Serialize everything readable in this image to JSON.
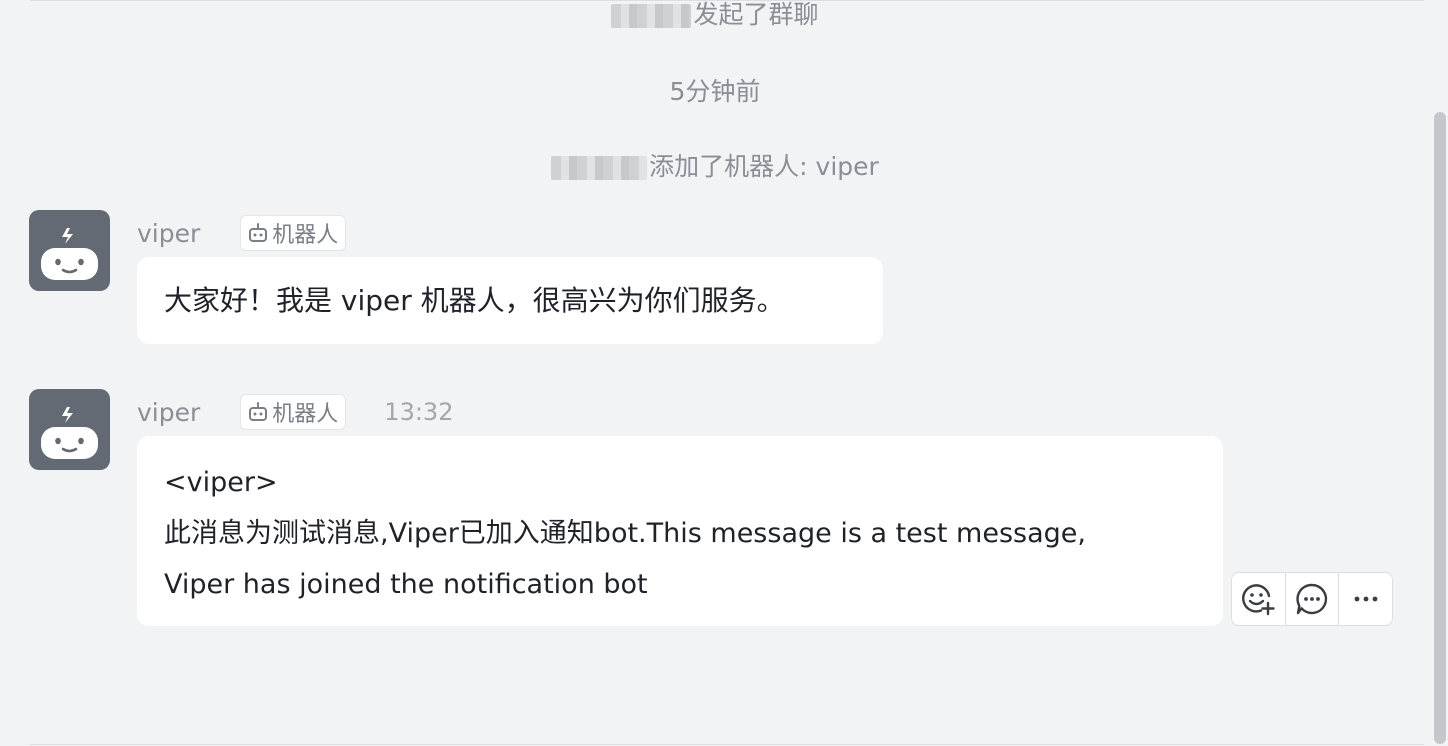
{
  "system_events": {
    "group_created_text": "发起了群聊",
    "time_divider": "5分钟前",
    "bot_added_text": "添加了机器人: viper"
  },
  "messages": [
    {
      "sender": "viper",
      "tag": "机器人",
      "time": "",
      "lines": [
        "大家好！我是 viper 机器人，很高兴为你们服务。"
      ]
    },
    {
      "sender": "viper",
      "tag": "机器人",
      "time": "13:32",
      "lines": [
        "<viper>",
        "此消息为测试消息,Viper已加入通知bot.This message is a test message,",
        "Viper has joined the notification bot"
      ]
    }
  ],
  "message_actions": {
    "icons": [
      "emoji-reaction-icon",
      "reply-icon",
      "more-icon"
    ]
  },
  "colors": {
    "background": "#f2f3f5",
    "avatar_bg": "#646a73",
    "bubble_bg": "#ffffff",
    "text_primary": "#1f2329",
    "text_secondary": "#8a8e96"
  }
}
